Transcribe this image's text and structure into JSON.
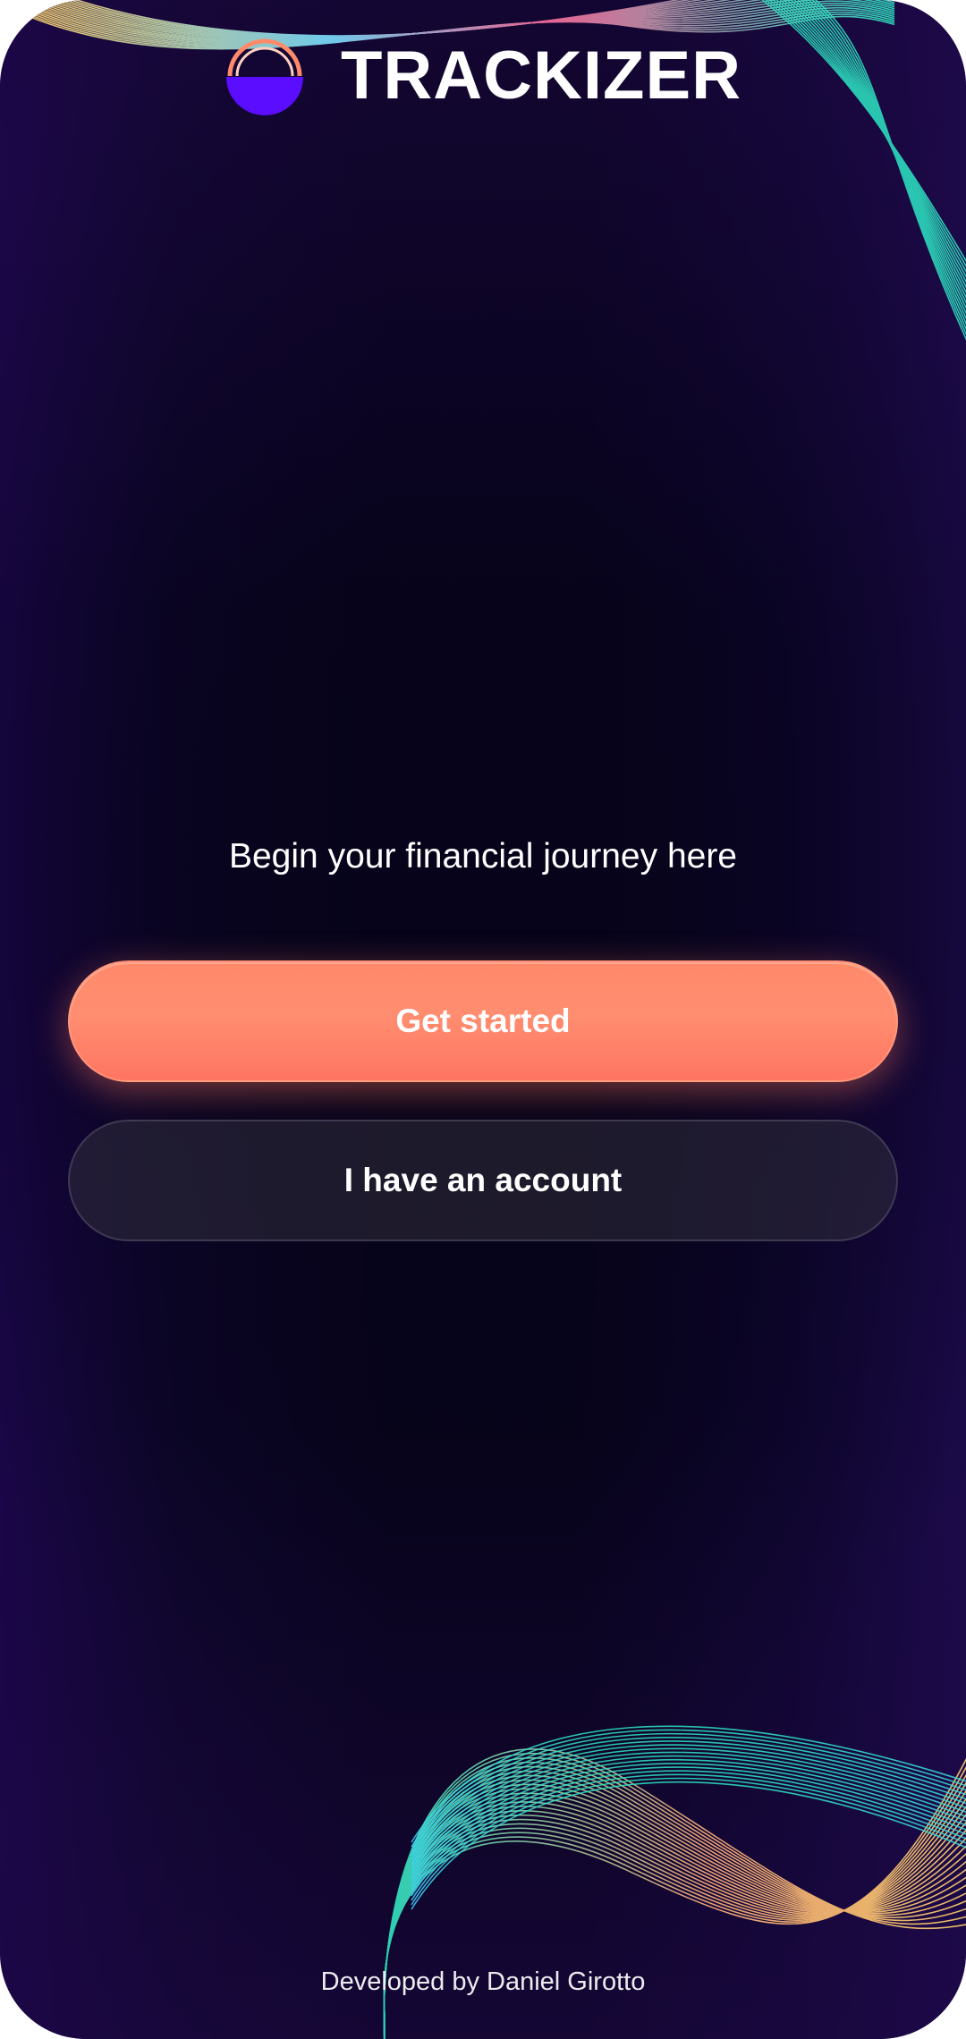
{
  "app": {
    "logo_text": "TRACKIZER",
    "tagline": "Begin your financial journey here",
    "footer": "Developed by Daniel Girotto"
  },
  "buttons": {
    "get_started": "Get started",
    "have_account": "I have an account"
  },
  "colors": {
    "background": "#07041a",
    "primary_button": "#ff8a6a",
    "secondary_button": "#2a2535",
    "logo_purple": "#5b0dff",
    "logo_ring": "#ff8a6a",
    "wave_cyan": "#2ee6c4",
    "wave_pink": "#ff6fa0",
    "wave_yellow": "#ffd36b"
  },
  "icons": {
    "logo": "trackizer-logo-icon"
  }
}
